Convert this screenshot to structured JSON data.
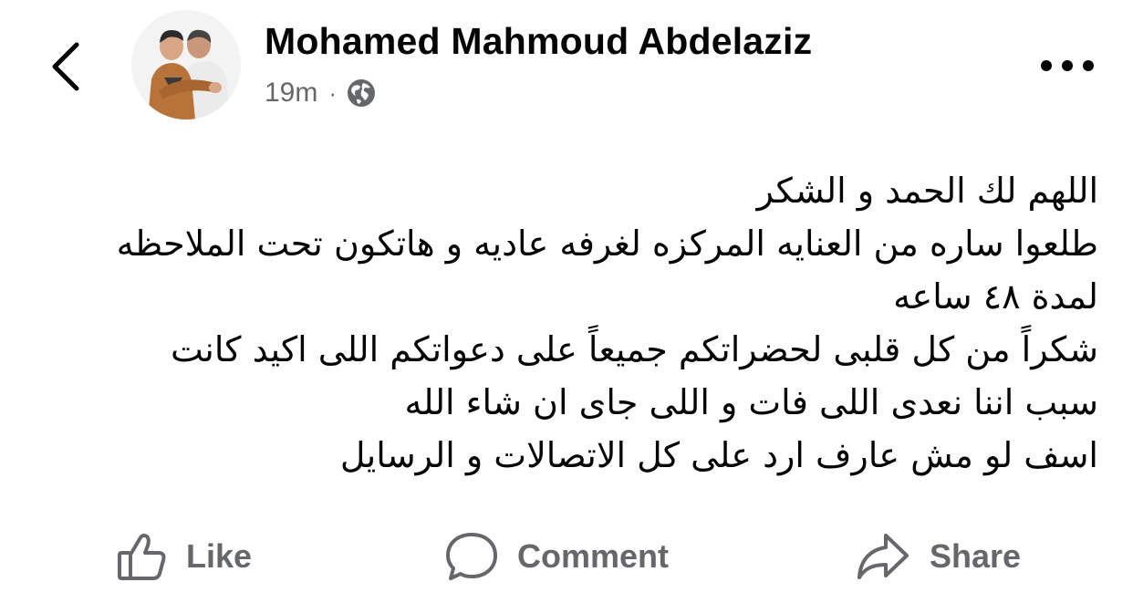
{
  "post": {
    "author": "Mohamed Mahmoud Abdelaziz",
    "time": "19m",
    "separator": "·",
    "privacy_icon": "globe-icon",
    "more_icon": "more-dots-icon",
    "back_icon": "chevron-left-icon",
    "body_lines": [
      "اللهم لك الحمد و الشكر",
      "طلعوا ساره من العنايه المركزه لغرفه عاديه و هاتكون تحت الملاحظه",
      "لمدة ٤٨ ساعه",
      "شكراً من كل قلبى لحضراتكم جميعاً على دعواتكم اللى اكيد كانت",
      "سبب اننا نعدى اللى فات و اللى جاى ان شاء الله",
      "اسف لو مش عارف ارد على كل الاتصالات و الرسايل"
    ]
  },
  "actions": {
    "like": {
      "label": "Like",
      "icon": "thumbs-up-icon"
    },
    "comment": {
      "label": "Comment",
      "icon": "comment-bubble-icon"
    },
    "share": {
      "label": "Share",
      "icon": "share-arrow-icon"
    }
  },
  "colors": {
    "text_primary": "#050505",
    "text_secondary": "#65676b",
    "background": "#ffffff"
  }
}
